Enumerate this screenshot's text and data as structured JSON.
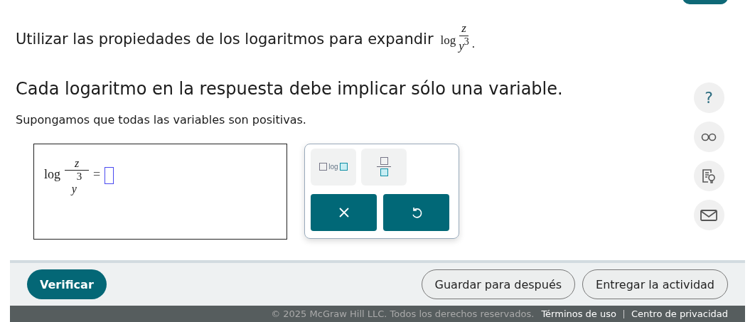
{
  "question": {
    "prompt": "Utilizar las propiedades de los logaritmos para expandir",
    "expression": {
      "function": "log",
      "numerator": "z",
      "denominator": "y",
      "exponent": "3"
    },
    "end_mark": ".",
    "instruction": "Cada logaritmo en la respuesta debe implicar sólo una variable.",
    "note": "Supongamos que todas las variables son positivas."
  },
  "answer": {
    "function": "log",
    "numerator": "z",
    "denominator": "y",
    "exponent": "3",
    "equals": "="
  },
  "palette": {
    "template_buttons": [
      {
        "kind": "log",
        "label": "log"
      },
      {
        "kind": "fraction"
      }
    ],
    "action_buttons": [
      {
        "kind": "clear"
      },
      {
        "kind": "undo"
      }
    ]
  },
  "tools": [
    {
      "kind": "help",
      "label": "?"
    },
    {
      "kind": "glasses"
    },
    {
      "kind": "hint"
    },
    {
      "kind": "mail"
    }
  ],
  "footer_buttons": [
    {
      "label": "Verificar",
      "primary": true
    },
    {
      "label": "Guardar para después",
      "primary": false
    },
    {
      "label": "Entregar la actividad",
      "primary": false
    }
  ],
  "copyright": "© 2025 McGraw Hill LLC. Todos los derechos reservados.",
  "links": [
    "Términos de uso",
    "Centro de privacidad"
  ]
}
